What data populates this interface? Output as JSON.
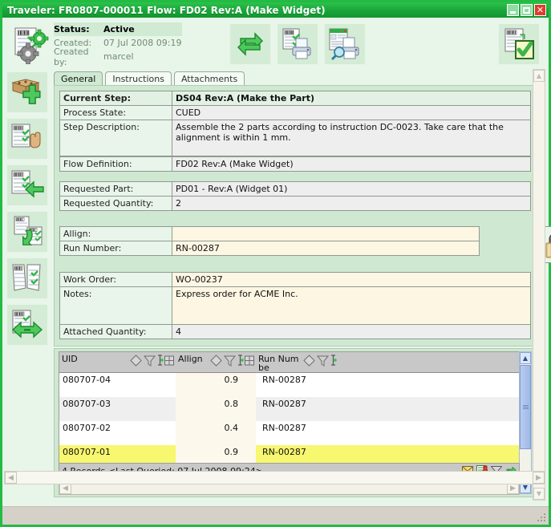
{
  "window": {
    "title": "Traveler: FR0807-000011 Flow: FD02 Rev:A (Make Widget)",
    "minimize_label": "Minimize",
    "maximize_label": "Maximize",
    "close_label": "Close"
  },
  "header": {
    "status_label": "Status:",
    "status_value": "Active",
    "created_label": "Created:",
    "created_value": "07 Jul 2008 09:19",
    "created_by_label": "Created by:",
    "created_by_value": "marcel",
    "buttons": [
      {
        "name": "refresh-button",
        "icon": "refresh-arrows-icon"
      },
      {
        "name": "print-traveler-button",
        "icon": "document-printer-icon"
      },
      {
        "name": "print-preview-button",
        "icon": "document-printer-preview-icon"
      },
      {
        "name": "complete-step-button",
        "icon": "document-checkmark-icon"
      }
    ]
  },
  "left_toolbar": [
    {
      "name": "add-part-button",
      "icon": "box-plus-icon"
    },
    {
      "name": "hold-traveler-button",
      "icon": "document-hand-icon"
    },
    {
      "name": "move-back-button",
      "icon": "document-left-arrow-icon"
    },
    {
      "name": "rework-button",
      "icon": "document-cycle-arrow-icon"
    },
    {
      "name": "split-traveler-button",
      "icon": "document-split-icon"
    },
    {
      "name": "move-button",
      "icon": "document-double-arrow-icon"
    }
  ],
  "tabs": [
    {
      "label": "General",
      "selected": true
    },
    {
      "label": "Instructions",
      "selected": false
    },
    {
      "label": "Attachments",
      "selected": false
    }
  ],
  "form": {
    "group1": [
      {
        "label": "Current Step:",
        "value": "DS04 Rev:A (Make the Part)",
        "bold": true,
        "style": "bold"
      },
      {
        "label": "Process State:",
        "value": "CUED",
        "style": "grey"
      },
      {
        "label": "Step Description:",
        "value": "Assemble the 2 parts according to instruction DC-0023. Take care that the alignment is within 1 mm.",
        "style": "grey"
      }
    ],
    "group2": [
      {
        "label": "Flow Definition:",
        "value": "FD02 Rev:A (Make Widget)",
        "style": "grey"
      }
    ],
    "group3": [
      {
        "label": "Requested Part:",
        "value": "PD01 - Rev:A (Widget 01)",
        "style": "grey"
      },
      {
        "label": "Requested Quantity:",
        "value": "2",
        "style": "grey"
      }
    ],
    "group4": [
      {
        "label": "Allign:",
        "value": "",
        "style": "cream"
      },
      {
        "label": "Run Number:",
        "value": "RN-00287",
        "style": "cream"
      }
    ],
    "group5": [
      {
        "label": "Work Order:",
        "value": "WO-00237",
        "style": "cream"
      },
      {
        "label": "Notes:",
        "value": "Express order for ACME Inc.",
        "style": "cream"
      },
      {
        "label": "Attached Quantity:",
        "value": "4",
        "style": "grey"
      }
    ],
    "lock_icon": "padlock-icon"
  },
  "grid": {
    "columns": [
      {
        "label": "UID",
        "filter_icons": [
          "diamond-sort-icon",
          "funnel-filter-icon",
          "text-cursor-icon",
          "grid-columns-icon"
        ]
      },
      {
        "label": "Allign",
        "filter_icons": [
          "diamond-sort-icon",
          "funnel-filter-icon",
          "text-cursor-icon",
          "grid-columns-icon"
        ]
      },
      {
        "label": "Run Numbe",
        "filter_icons": [
          "diamond-sort-icon",
          "funnel-filter-icon",
          "text-cursor-icon"
        ]
      }
    ],
    "rows": [
      {
        "uid": "080707-04",
        "allign": "0.9",
        "run_number": "RN-00287",
        "selected": false
      },
      {
        "uid": "080707-03",
        "allign": "0.8",
        "run_number": "RN-00287",
        "selected": false
      },
      {
        "uid": "080707-02",
        "allign": "0.4",
        "run_number": "RN-00287",
        "selected": false
      },
      {
        "uid": "080707-01",
        "allign": "0.9",
        "run_number": "RN-00287",
        "selected": true
      }
    ],
    "status_text": "4 Records <Last Queried: 07 Jul 2008 09:24>",
    "status_icons": [
      {
        "name": "mail-envelope-icon"
      },
      {
        "name": "export-document-icon"
      },
      {
        "name": "funnel-filter-icon"
      },
      {
        "name": "refresh-icon"
      }
    ]
  },
  "colors": {
    "titlebar_green": "#18a538",
    "window_border": "#22bb44",
    "panel_green": "#cfe8d1",
    "client_green": "#e8f5e9",
    "icon_bg": "#d4ebd6",
    "row_selected": "#f7f770",
    "cream_field": "#fdf6e3",
    "grey_field": "#eeeeee",
    "grid_header": "#c8c8c8"
  }
}
